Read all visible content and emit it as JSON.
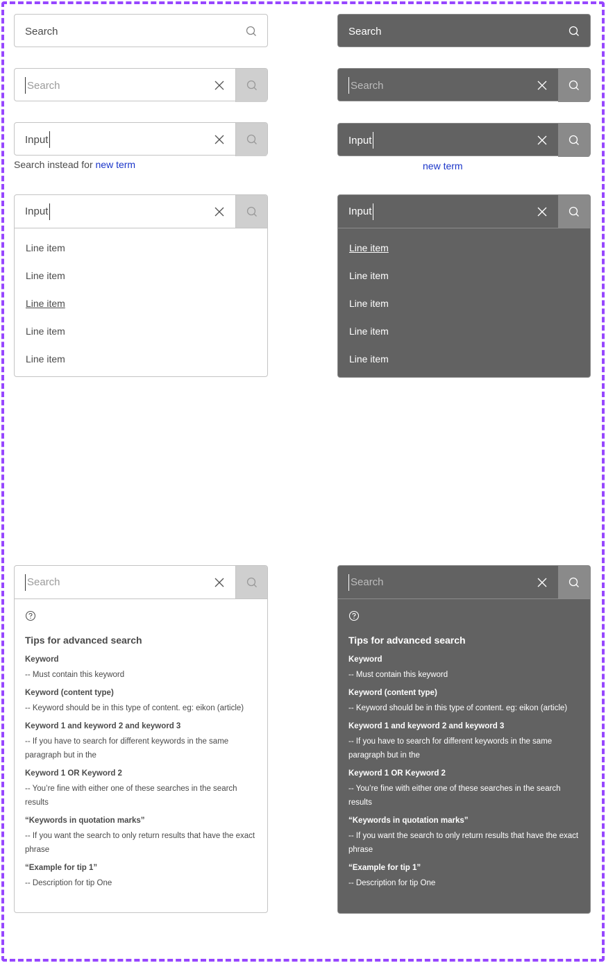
{
  "search": {
    "placeholder": "Search",
    "input_value": "Input"
  },
  "suggestion": {
    "prefix": "Search instead for",
    "link": "new term"
  },
  "dropdown": {
    "items": [
      "Line item",
      "Line item",
      "Line item",
      "Line item",
      "Line item"
    ]
  },
  "tips": {
    "title": "Tips for advanced search",
    "items": [
      {
        "title": "Keyword",
        "desc": "-- Must contain this keyword"
      },
      {
        "title": "Keyword (content type)",
        "desc": "-- Keyword should be in this type of content. eg: eikon (article)"
      },
      {
        "title": "Keyword 1 and keyword 2 and keyword 3",
        "desc": "-- If you have to search for different keywords in the same paragraph but in the"
      },
      {
        "title": "Keyword 1 OR Keyword 2",
        "desc": "-- You’re fine with either one of these searches in the search results"
      },
      {
        "title": "“Keywords in quotation marks”",
        "desc": "-- If you want the search to only return results that have the exact phrase"
      },
      {
        "title": "“Example for tip 1”",
        "desc": "-- Description for tip One"
      }
    ]
  },
  "colors": {
    "frame": "#9747ff",
    "dark_surface": "#626262",
    "link": "#1a35c9"
  },
  "icons": [
    "search-icon",
    "close-icon",
    "help-circle-icon"
  ]
}
